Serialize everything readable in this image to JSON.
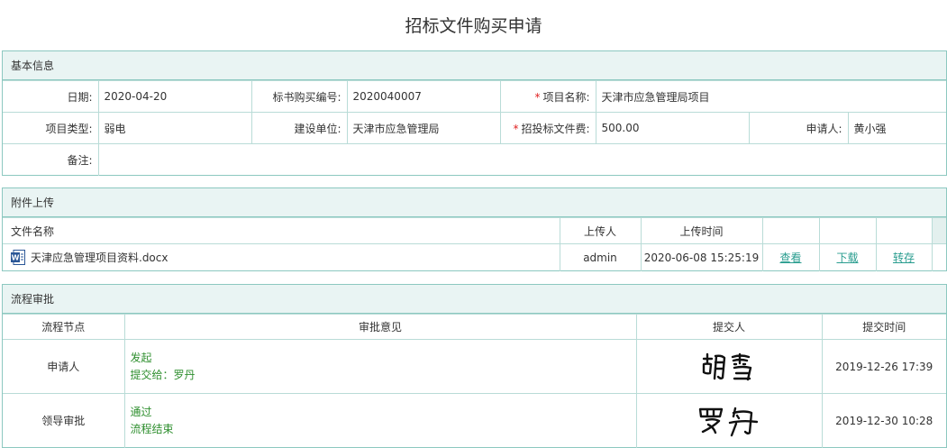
{
  "page": {
    "title": "招标文件购买申请"
  },
  "basic": {
    "header": "基本信息",
    "date_label": "日期:",
    "date_value": "2020-04-20",
    "bid_no_label": "标书购买编号:",
    "bid_no_value": "2020040007",
    "required_mark": "*",
    "project_name_label": "项目名称:",
    "project_name_value": "天津市应急管理局项目",
    "project_type_label": "项目类型:",
    "project_type_value": "弱电",
    "builder_label": "建设单位:",
    "builder_value": "天津市应急管理局",
    "fee_label": "招投标文件费:",
    "fee_value": "500.00",
    "applicant_label": "申请人:",
    "applicant_value": "黄小强",
    "note_label": "备注:",
    "note_value": ""
  },
  "attachments": {
    "header": "附件上传",
    "columns": [
      "文件名称",
      "上传人",
      "上传时间"
    ],
    "rows": [
      {
        "file_name": "天津应急管理项目资料.docx",
        "uploader": "admin",
        "upload_time": "2020-06-08 15:25:19",
        "view_label": "查看",
        "download_label": "下载",
        "transfer_label": "转存",
        "icon": "word-file-icon"
      }
    ],
    "icon_color": "#2b5797",
    "link_color": "#2a9d8f"
  },
  "workflow": {
    "header": "流程审批",
    "columns": [
      "流程节点",
      "审批意见",
      "提交人",
      "提交时间"
    ],
    "rows": [
      {
        "node": "申请人",
        "opinion_line1": "发起",
        "opinion_line2": "提交给：罗丹",
        "submitter_signature": "胡雪",
        "submit_time": "2019-12-26 17:39"
      },
      {
        "node": "领导审批",
        "opinion_line1": "通过",
        "opinion_line2": "流程结束",
        "submitter_signature": "罗丹",
        "submit_time": "2019-12-30 10:28"
      }
    ],
    "opinion_color": "#2f8f2f"
  },
  "theme": {
    "border": "#8cc8c0",
    "header_bg": "#e9f4f3",
    "required": "#e02020"
  }
}
